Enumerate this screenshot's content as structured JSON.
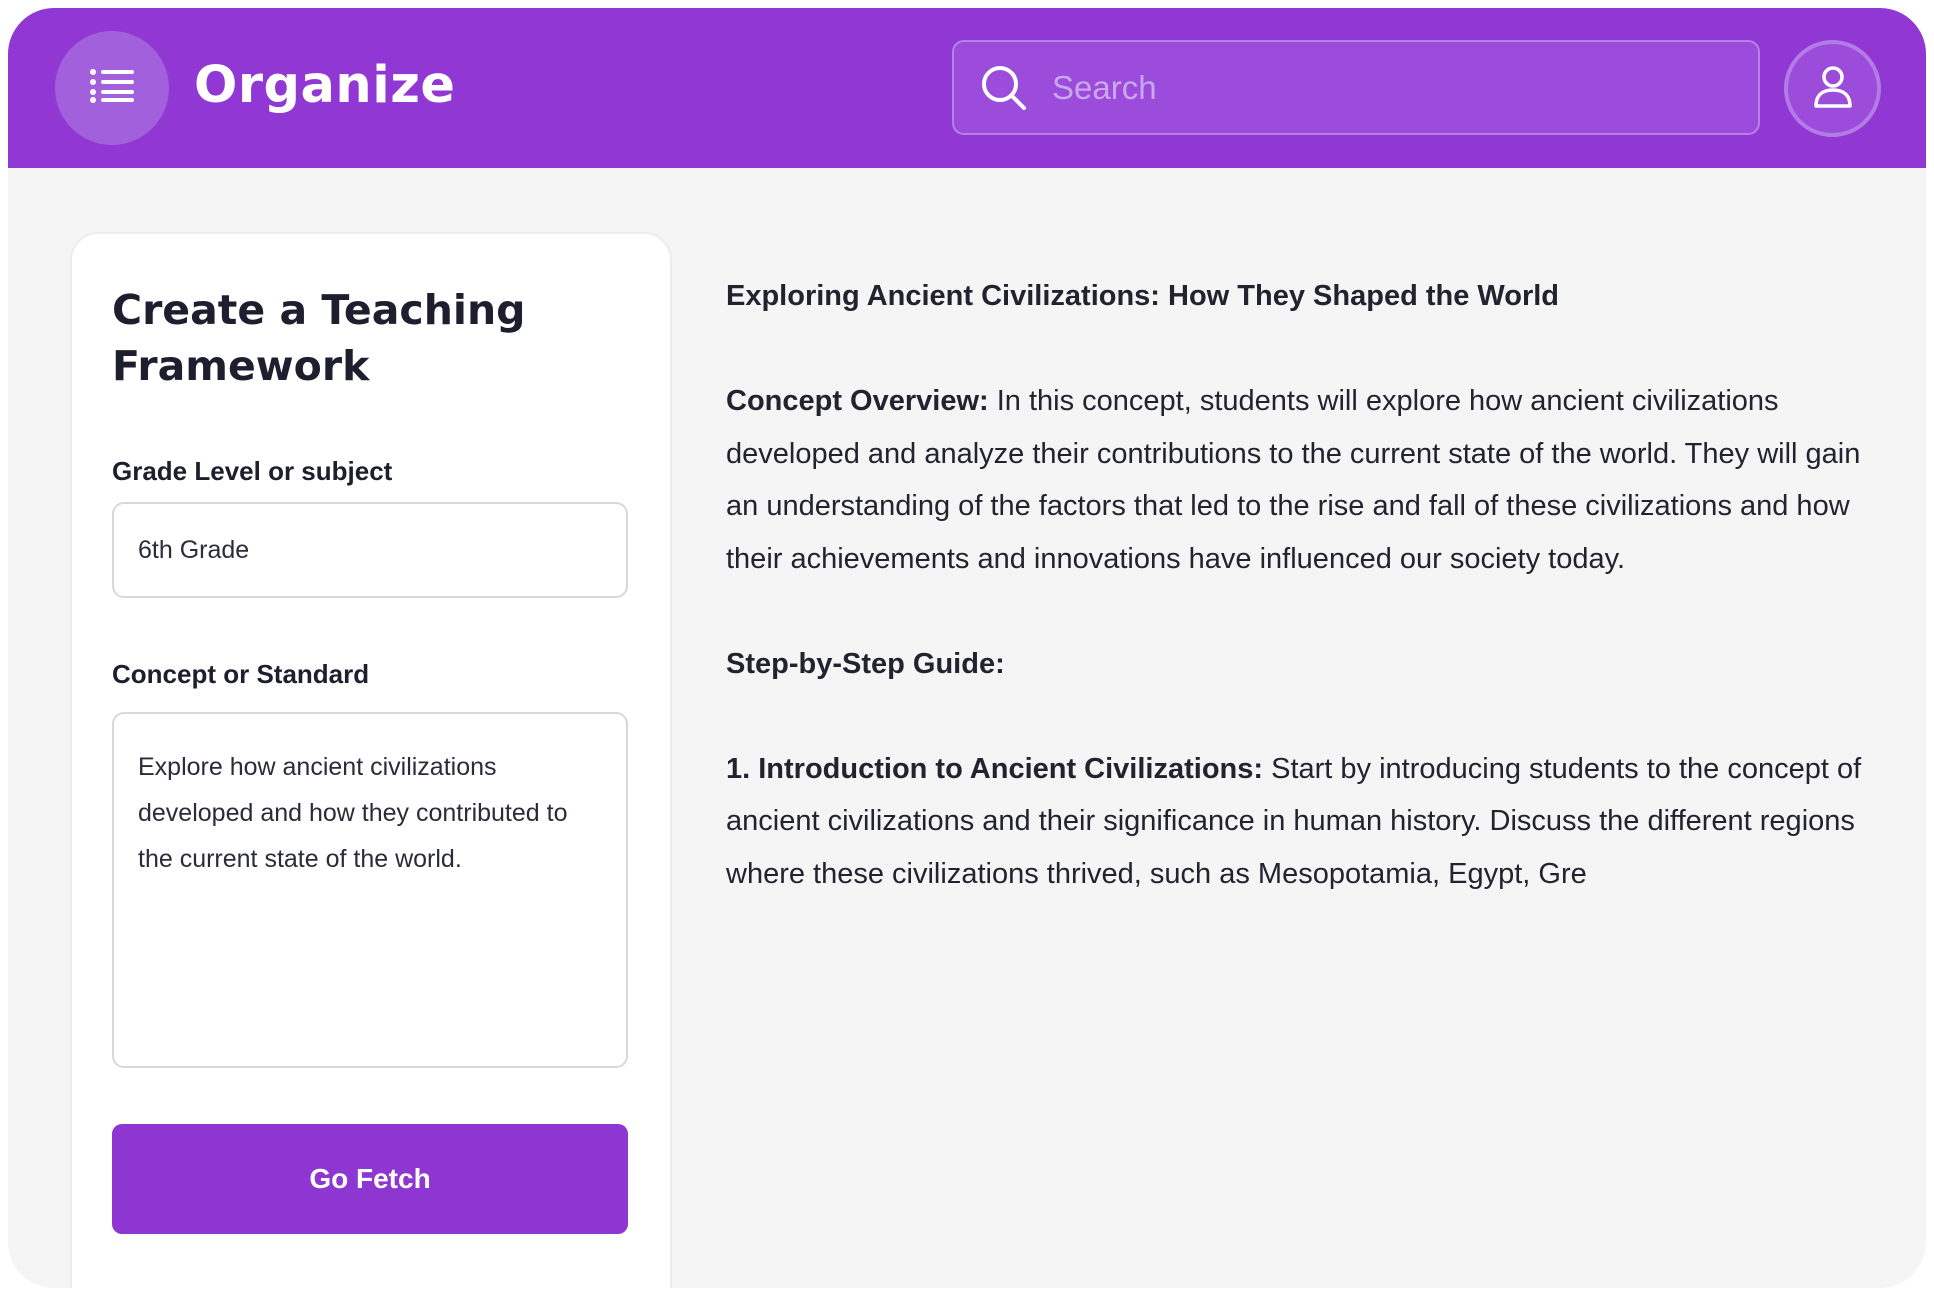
{
  "header": {
    "app_title": "Organize",
    "search_placeholder": "Search",
    "brand_color": "#9138d4"
  },
  "form": {
    "title": "Create a Teaching Framework",
    "grade_label": "Grade Level or subject",
    "grade_value": "6th Grade",
    "concept_label": "Concept or Standard",
    "concept_value": "Explore how ancient civilizations developed and how they contributed to the current state of the world.",
    "submit_label": "Go Fetch"
  },
  "output": {
    "title": "Exploring Ancient Civilizations: How They Shaped the World",
    "overview_heading": "Concept Overview:",
    "overview_text": " In this concept, students will explore how ancient civilizations developed and analyze their contributions to the current state of the world. They will gain an understanding of the factors that led to the rise and fall of these civilizations and how their achievements and innovations have influenced our society today.",
    "guide_heading": "Step-by-Step Guide:",
    "step1_heading": "1. Introduction to Ancient Civilizations:",
    "step1_text": " Start by introducing students to the concept of ancient civilizations and their significance in human history. Discuss the different regions where these civilizations thrived, such as Mesopotamia, Egypt, Gre"
  },
  "icons": {
    "menu": "list-icon",
    "search": "search-icon",
    "user": "user-icon"
  }
}
